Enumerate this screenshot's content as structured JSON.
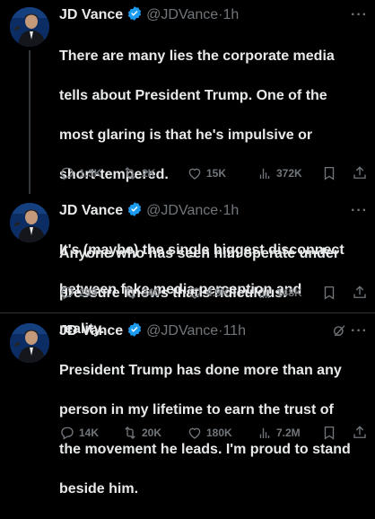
{
  "colors": {
    "background": "#000000",
    "text": "#e7e9ea",
    "muted": "#71767b",
    "verified": "#1d9bf0",
    "divider": "#2f3336"
  },
  "tweets": [
    {
      "name": "JD Vance",
      "handle": "@JDVance",
      "dot": "·",
      "time": "1h",
      "lines": [
        "There are many lies the corporate media",
        "tells about President Trump. One of the",
        "most glaring is that he's impulsive or",
        "short-tempered.",
        "",
        "Anyone who has seen him operate under",
        "pressure knows that's ridiculous."
      ],
      "replies": "1.3K",
      "reposts": "2K",
      "likes": "15K",
      "views": "372K"
    },
    {
      "name": "JD Vance",
      "handle": "@JDVance",
      "dot": "·",
      "time": "1h",
      "lines": [
        "It's (maybe) the single biggest disconnect",
        "between fake media perception and",
        "reality."
      ],
      "replies": "293",
      "reposts": "340",
      "likes": "4.9K",
      "views": "148K"
    },
    {
      "name": "JD Vance",
      "handle": "@JDVance",
      "dot": "·",
      "time": "11h",
      "lines": [
        "President Trump has done more than any",
        "person in my lifetime to earn the trust of",
        "the movement he leads. I'm proud to stand",
        "beside him."
      ],
      "replies": "14K",
      "reposts": "20K",
      "likes": "180K",
      "views": "7.2M"
    }
  ]
}
